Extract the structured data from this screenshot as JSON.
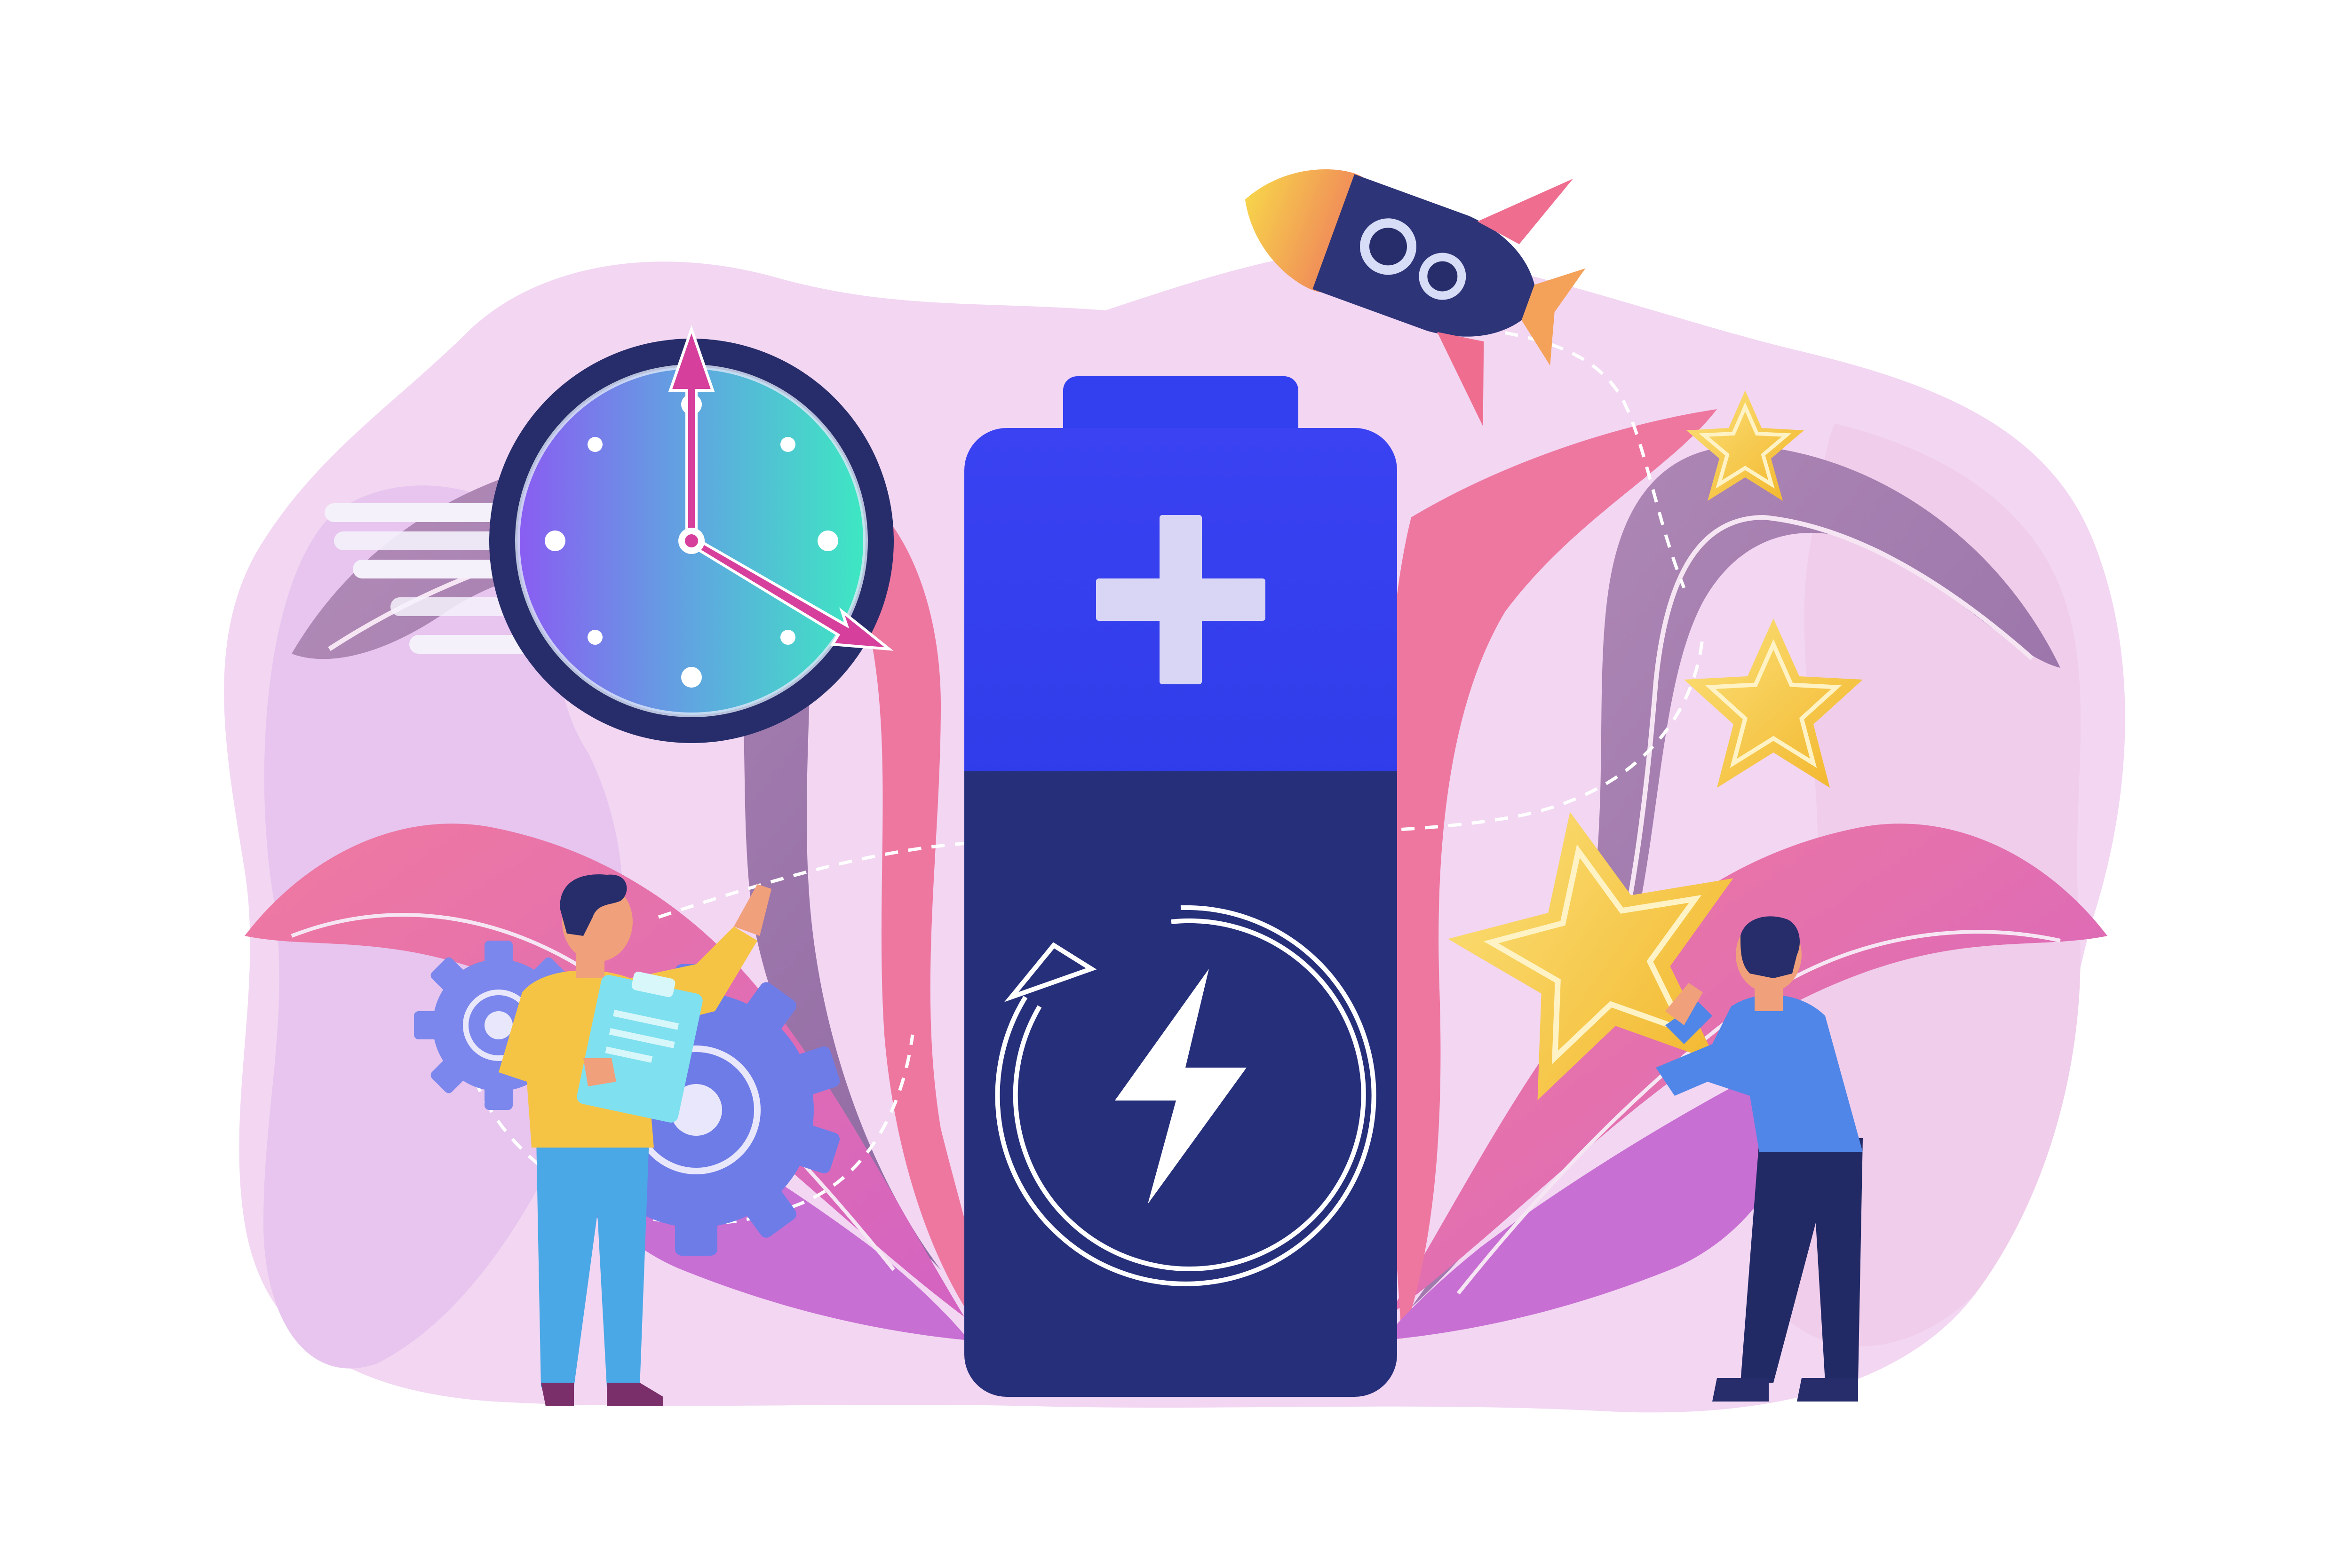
{
  "illustration": {
    "palette": {
      "background": "#ffffff",
      "blob_light": "#f1d3f1",
      "blob_mid": "#e6c3ef",
      "leaf_pink": "#ef7ba1",
      "leaf_mauve": "#a07aa8",
      "leaf_purple": "#c36fd0",
      "battery_top": "#3340f0",
      "battery_bottom": "#262f7a",
      "plus_sign": "#d7d3f3",
      "clock_rim": "#262d6a",
      "clock_face_a": "#7f5cf0",
      "clock_face_b": "#3fe6c5",
      "clock_hand": "#d63f9c",
      "gear": "#7a86ec",
      "star": "#f6cb3c",
      "star_outline": "#fff3c6",
      "rocket_body": "#2d3478",
      "rocket_flame": "#f7c443",
      "rocket_fin": "#ef6e8f",
      "skin": "#f0a07b",
      "hair": "#262d6a",
      "shirt_yellow": "#f6c445",
      "shirt_blue": "#4f86e8",
      "pants_light": "#4aa8e6",
      "pants_dark": "#222a66",
      "shoe": "#7b2f6a",
      "clipboard": "#7fe0f0"
    },
    "icons": [
      "battery-icon",
      "plus-icon",
      "charging-bolt-icon",
      "recharge-arrow-icon",
      "clock-icon",
      "rocket-icon",
      "star-icon",
      "gear-icon",
      "clipboard-icon"
    ]
  }
}
